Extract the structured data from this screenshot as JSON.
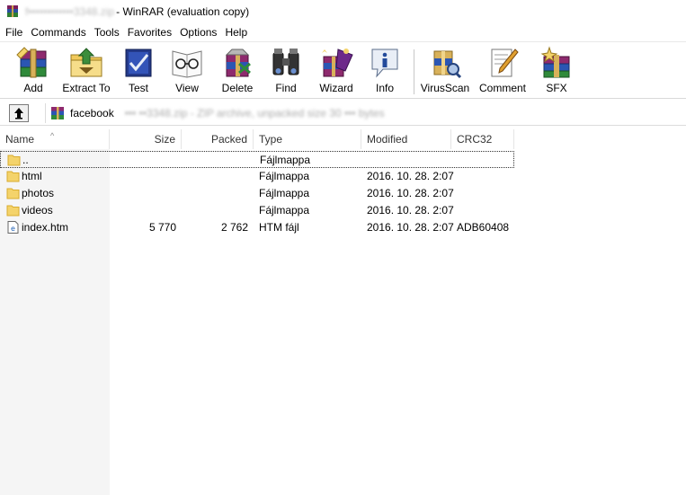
{
  "window": {
    "title_obscured": "f••••••••••••3348.zip",
    "title_suffix": " - WinRAR (evaluation copy)"
  },
  "menu": [
    "File",
    "Commands",
    "Tools",
    "Favorites",
    "Options",
    "Help"
  ],
  "toolbar": [
    {
      "label": "Add",
      "icon": "add-archive-icon"
    },
    {
      "label": "Extract To",
      "icon": "extract-folder-icon"
    },
    {
      "label": "Test",
      "icon": "test-check-icon"
    },
    {
      "label": "View",
      "icon": "view-glasses-icon"
    },
    {
      "label": "Delete",
      "icon": "delete-icon"
    },
    {
      "label": "Find",
      "icon": "binoculars-icon"
    },
    {
      "label": "Wizard",
      "icon": "wizard-icon"
    },
    {
      "label": "Info",
      "icon": "info-icon"
    },
    {
      "label": "VirusScan",
      "icon": "virus-scan-icon"
    },
    {
      "label": "Comment",
      "icon": "comment-icon"
    },
    {
      "label": "SFX",
      "icon": "sfx-icon"
    }
  ],
  "address": {
    "visible": "facebook",
    "obscured": "••• ••3348.zip - ZIP archive, unpacked size 30 ••• bytes"
  },
  "columns": {
    "name": "Name",
    "size": "Size",
    "packed": "Packed",
    "type": "Type",
    "modified": "Modified",
    "crc": "CRC32"
  },
  "files": [
    {
      "name": "..",
      "size": "",
      "packed": "",
      "type": "Fájlmappa",
      "modified": "",
      "crc": "",
      "icon": "folder-icon"
    },
    {
      "name": "html",
      "size": "",
      "packed": "",
      "type": "Fájlmappa",
      "modified": "2016. 10. 28. 2:07",
      "crc": "",
      "icon": "folder-icon"
    },
    {
      "name": "photos",
      "size": "",
      "packed": "",
      "type": "Fájlmappa",
      "modified": "2016. 10. 28. 2:07",
      "crc": "",
      "icon": "folder-icon"
    },
    {
      "name": "videos",
      "size": "",
      "packed": "",
      "type": "Fájlmappa",
      "modified": "2016. 10. 28. 2:07",
      "crc": "",
      "icon": "folder-icon"
    },
    {
      "name": "index.htm",
      "size": "5 770",
      "packed": "2 762",
      "type": "HTM fájl",
      "modified": "2016. 10. 28. 2:07",
      "crc": "ADB60408",
      "icon": "htm-file-icon"
    }
  ],
  "colors": {
    "folder": "#f4d36b",
    "folder_dark": "#d9ac2e",
    "name_column_bg": "#f5f5f5"
  }
}
